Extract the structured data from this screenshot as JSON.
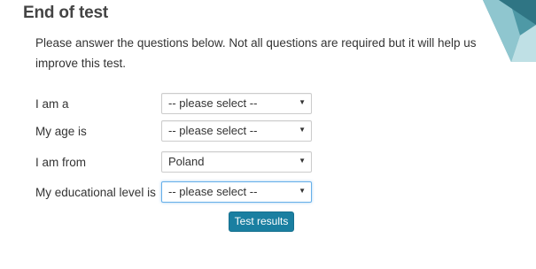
{
  "page": {
    "title": "End of test",
    "intro": "Please answer the questions below. Not all questions are required but it will help us improve this test."
  },
  "form": {
    "fields": [
      {
        "label": "I am a",
        "value": "-- please select --"
      },
      {
        "label": "My age is",
        "value": "-- please select --"
      },
      {
        "label": "I am from",
        "value": "Poland"
      },
      {
        "label": "My educational level is",
        "value": "-- please select --"
      }
    ],
    "focused_field": "My educational level is",
    "submit_label": "Test results"
  },
  "icons": {
    "dropdown": "caret-down-icon"
  },
  "colors": {
    "button": "#1a7fa1",
    "title": "#444444",
    "decor": "#5fa8b4"
  }
}
